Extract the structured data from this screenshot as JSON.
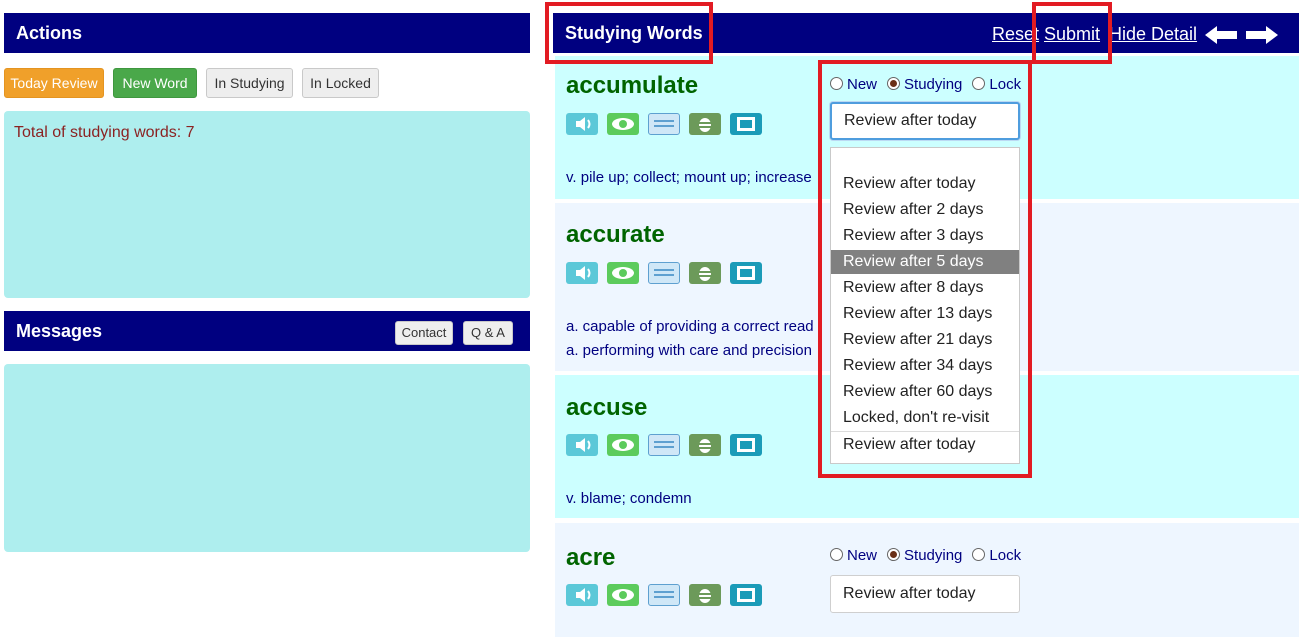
{
  "actions": {
    "title": "Actions",
    "buttons": {
      "today_review": "Today Review",
      "new_word": "New Word",
      "in_studying": "In Studying",
      "in_locked": "In Locked"
    },
    "total_text": "Total of studying words: 7"
  },
  "messages": {
    "title": "Messages",
    "contact": "Contact",
    "qa": "Q & A"
  },
  "studying": {
    "title": "Studying Words",
    "reset": "Reset",
    "submit": "Submit",
    "hide_detail": "Hide Detail"
  },
  "words": [
    {
      "word": "accumulate",
      "defs": [
        "v. pile up; collect; mount up; increase"
      ],
      "radios": [
        "New",
        "Studying",
        "Lock"
      ],
      "selected_radio": "Studying",
      "select_value": "Review after today"
    },
    {
      "word": "accurate",
      "defs": [
        "a. capable of providing a correct read",
        "a. performing with care and precision"
      ]
    },
    {
      "word": "accuse",
      "defs": [
        "v. blame; condemn"
      ]
    },
    {
      "word": "acre",
      "radios": [
        "New",
        "Studying",
        "Lock"
      ],
      "selected_radio": "Studying",
      "select_value": "Review after today"
    }
  ],
  "dropdown": {
    "options": [
      "Review after today",
      "Review after 2 days",
      "Review after 3 days",
      "Review after 5 days",
      "Review after 8 days",
      "Review after 13 days",
      "Review after 21 days",
      "Review after 34 days",
      "Review after 60 days",
      "Locked, don't re-visit"
    ],
    "highlighted": "Review after 5 days",
    "footer": "Review after today"
  },
  "icons": [
    "speaker-icon",
    "eye-icon",
    "card-icon",
    "bee-icon",
    "book-icon"
  ],
  "colors": {
    "header_bg": "#000080",
    "panel_cyan": "#aeeeee",
    "word_green": "#006400",
    "def_navy": "#000080",
    "highlight_red": "#e21b23",
    "orange": "#f0a02a",
    "green": "#4aa84a"
  }
}
